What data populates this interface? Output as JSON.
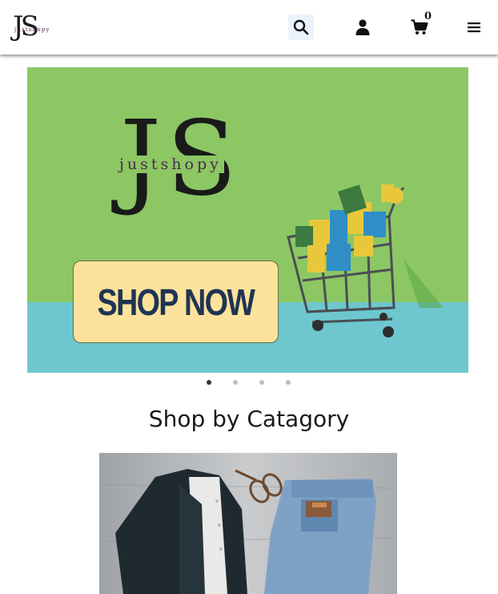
{
  "header": {
    "logo_initials": "JS",
    "logo_word": "justshopy",
    "cart_count": "0"
  },
  "banner": {
    "logo_initials_j": "J",
    "logo_initials_s": "S",
    "logo_word": "justshopy",
    "cta_label": "SHOP NOW"
  },
  "carousel": {
    "slides": 4,
    "active": 0
  },
  "section": {
    "title": "Shop by Catagory"
  },
  "colors": {
    "banner_green": "#8cc764",
    "banner_floor": "#6ec7cf",
    "cta_bg": "#fde29b",
    "cta_text": "#1f3454",
    "search_bg": "#eaf3fc"
  },
  "icons": [
    "search-icon",
    "user-icon",
    "cart-icon",
    "menu-icon"
  ]
}
